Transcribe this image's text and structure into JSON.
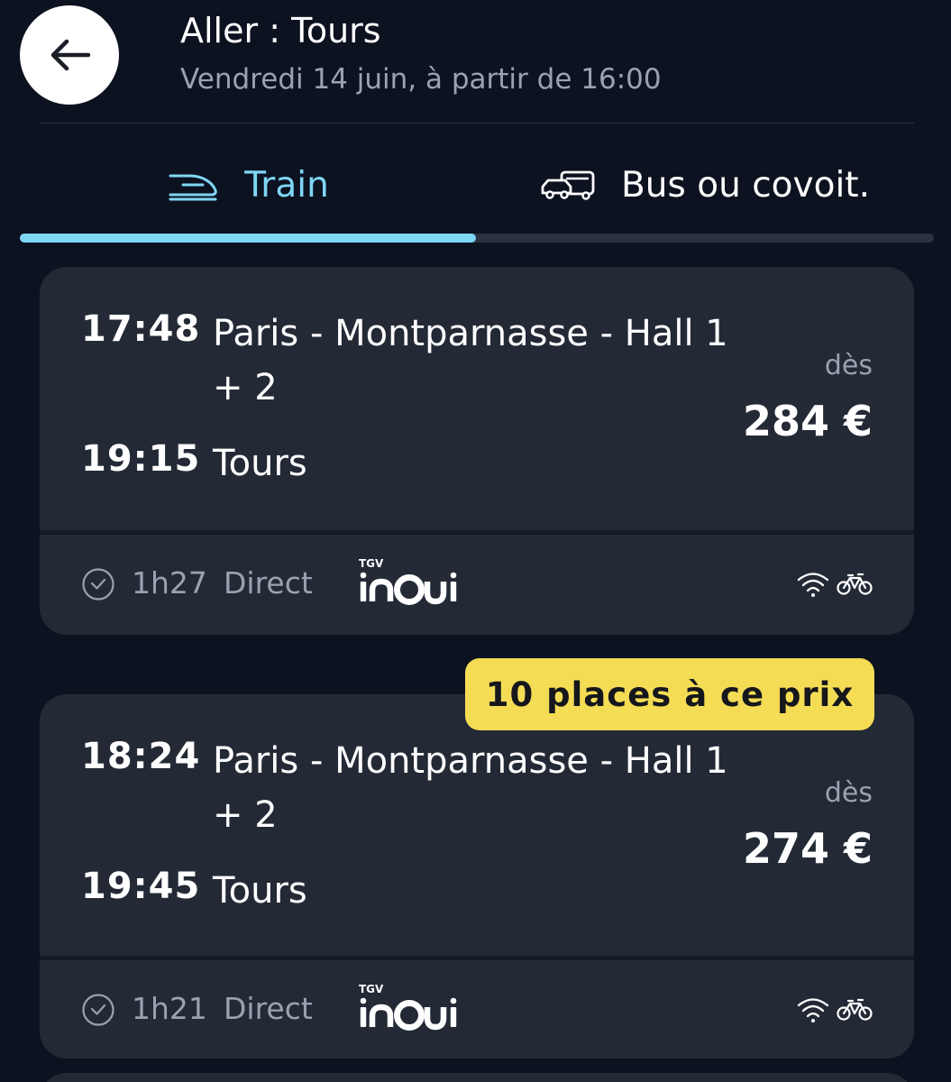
{
  "header": {
    "back_icon": "arrow-left-icon",
    "title": "Aller : Tours",
    "subtitle": "Vendredi 14 juin, à partir de 16:00"
  },
  "tabs": [
    {
      "label": "Train",
      "icon": "train-icon",
      "active": true
    },
    {
      "label": "Bus ou covoit.",
      "icon": "bus-car-icon",
      "active": false
    }
  ],
  "colors": {
    "accent": "#7fd6f5",
    "background": "#0c1220",
    "card": "#232a36",
    "badge": "#f4dc55"
  },
  "results": [
    {
      "departure_time": "17:48",
      "departure_station_line1": "Paris - Montparnasse - Hall 1",
      "departure_station_line2": "+ 2",
      "arrival_time": "19:15",
      "arrival_station": "Tours",
      "price_prefix": "dès",
      "price": "284 €",
      "duration": "1h27",
      "type": "Direct",
      "brand_small": "TGV",
      "brand_logo": "inoui-logo",
      "amenities": [
        "wifi-icon",
        "bike-icon"
      ]
    },
    {
      "badge": "10 places à ce prix",
      "departure_time": "18:24",
      "departure_station_line1": "Paris - Montparnasse - Hall 1",
      "departure_station_line2": "+ 2",
      "arrival_time": "19:45",
      "arrival_station": "Tours",
      "price_prefix": "dès",
      "price": "274 €",
      "duration": "1h21",
      "type": "Direct",
      "brand_small": "TGV",
      "brand_logo": "inoui-logo",
      "amenities": [
        "wifi-icon",
        "bike-icon"
      ]
    }
  ]
}
